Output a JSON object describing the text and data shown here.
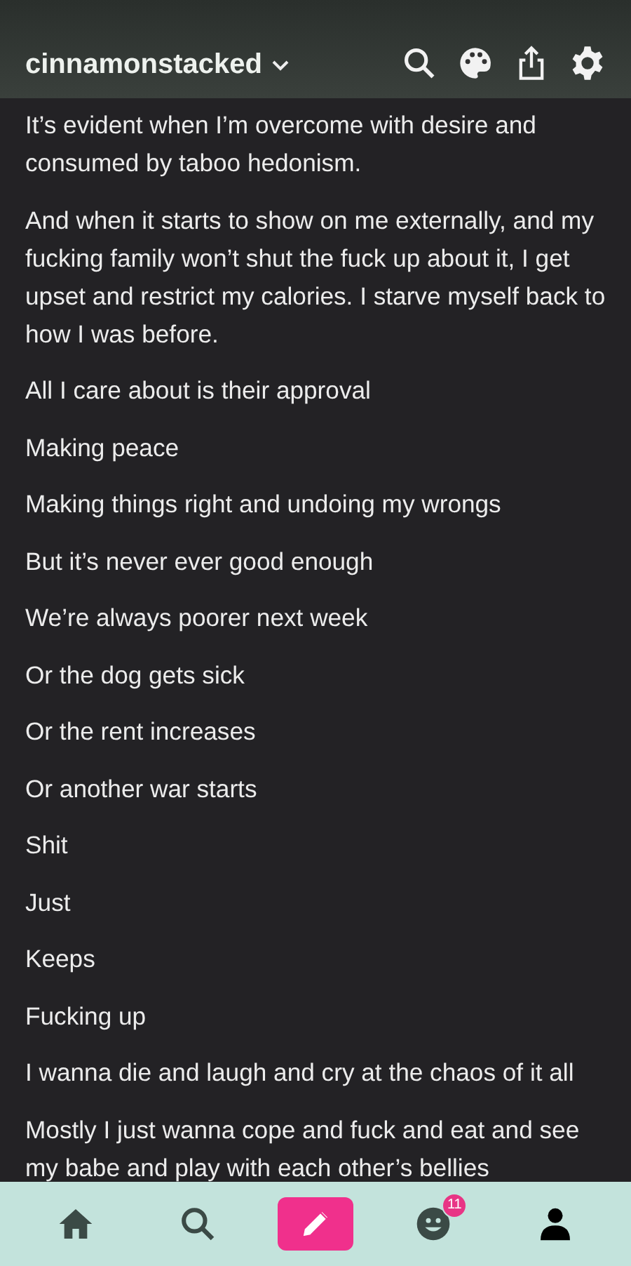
{
  "header": {
    "blog_name": "cinnamonstacked"
  },
  "paragraphs": [
    "It’s evident when I’m overcome with desire and consumed by taboo hedonism.",
    "And when it starts to show on me externally, and my fucking family won’t shut the fuck up about it, I get upset and restrict my calories. I starve myself back to how I was before.",
    "All I care about is their approval",
    "Making peace",
    "Making things right and undoing my wrongs",
    "But it’s never ever good enough",
    "We’re always poorer next week",
    "Or the dog gets sick",
    "Or the rent increases",
    "Or another war starts",
    "Shit",
    "Just",
    "Keeps",
    "Fucking up",
    "I wanna die and laugh and cry at the chaos of it all",
    "Mostly I just wanna cope and fuck and eat and see my babe and play with each other’s bellies"
  ],
  "nav": [
    {
      "kind": "home",
      "selected": false
    },
    {
      "kind": "search",
      "selected": false
    },
    {
      "kind": "compose",
      "selected": false
    },
    {
      "kind": "activity",
      "selected": false,
      "badge": "11"
    },
    {
      "kind": "account",
      "selected": true
    }
  ]
}
